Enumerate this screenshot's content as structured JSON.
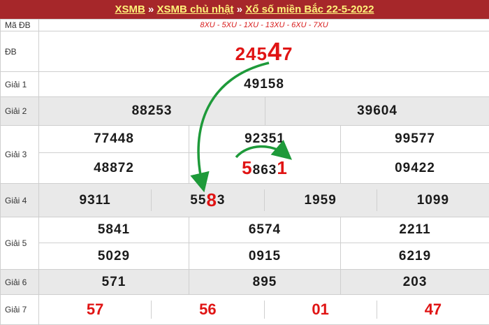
{
  "header": {
    "crumb1": "XSMB",
    "sep1": "»",
    "crumb2": "XSMB chủ nhật",
    "sep2": "»",
    "crumb3": "Xổ số miền Bắc 22-5-2022"
  },
  "labels": {
    "ma_db": "Mã ĐB",
    "db": "ĐB",
    "g1": "Giải 1",
    "g2": "Giải 2",
    "g3": "Giải 3",
    "g4": "Giải 4",
    "g5": "Giải 5",
    "g6": "Giải 6",
    "g7": "Giải 7"
  },
  "codes": "8XU - 5XU - 1XU - 13XU - 6XU - 7XU",
  "special": {
    "prefix": "245",
    "highlight": "4",
    "suffix": "7"
  },
  "g1": [
    "49158"
  ],
  "g2": [
    "88253",
    "39604"
  ],
  "g3": {
    "row1": [
      "77448",
      "92351",
      "99577"
    ],
    "row2_a": "48872",
    "row2_b": {
      "first": "5",
      "middle": "863",
      "last": "1"
    },
    "row2_c": "09422"
  },
  "g4": {
    "a": "9311",
    "b": {
      "prefix": "55",
      "highlight": "8",
      "suffix": "3"
    },
    "c": "1959",
    "d": "1099"
  },
  "g5": {
    "row1": [
      "5841",
      "6574",
      "2211"
    ],
    "row2": [
      "5029",
      "0915",
      "6219"
    ]
  },
  "g6": [
    "571",
    "895",
    "203"
  ],
  "g7": [
    "57",
    "56",
    "01",
    "47"
  ],
  "colors": {
    "header_bg": "#a6272a",
    "header_text": "#fff27a",
    "highlight": "#e01414",
    "arrow": "#1e9a3a",
    "row_gray": "#e9e9e9"
  }
}
